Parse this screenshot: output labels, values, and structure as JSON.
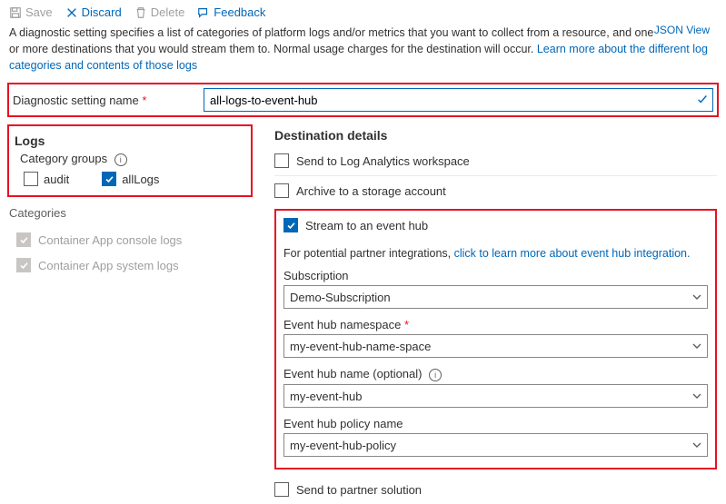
{
  "toolbar": {
    "save": "Save",
    "discard": "Discard",
    "delete": "Delete",
    "feedback": "Feedback"
  },
  "description": {
    "text1": "A diagnostic setting specifies a list of categories of platform logs and/or metrics that you want to collect from a resource, and one or more destinations that you would stream them to. Normal usage charges for the destination will occur. ",
    "link1": "Learn more about the different log categories and contents of those logs"
  },
  "json_view": "JSON View",
  "setting_name": {
    "label": "Diagnostic setting name",
    "value": "all-logs-to-event-hub"
  },
  "logs": {
    "title": "Logs",
    "cg_label": "Category groups",
    "audit": "audit",
    "all_logs": "allLogs",
    "categories_label": "Categories",
    "cat1": "Container App console logs",
    "cat2": "Container App system logs"
  },
  "dest": {
    "title": "Destination details",
    "law": "Send to Log Analytics workspace",
    "storage": "Archive to a storage account",
    "eventhub": "Stream to an event hub",
    "partner": "Send to partner solution"
  },
  "eh": {
    "note_prefix": "For potential partner integrations, ",
    "note_link": "click to learn more about event hub integration.",
    "sub_label": "Subscription",
    "sub_value": "Demo-Subscription",
    "ns_label": "Event hub namespace",
    "ns_value": "my-event-hub-name-space",
    "name_label": "Event hub name (optional)",
    "name_value": "my-event-hub",
    "policy_label": "Event hub policy name",
    "policy_value": "my-event-hub-policy"
  }
}
